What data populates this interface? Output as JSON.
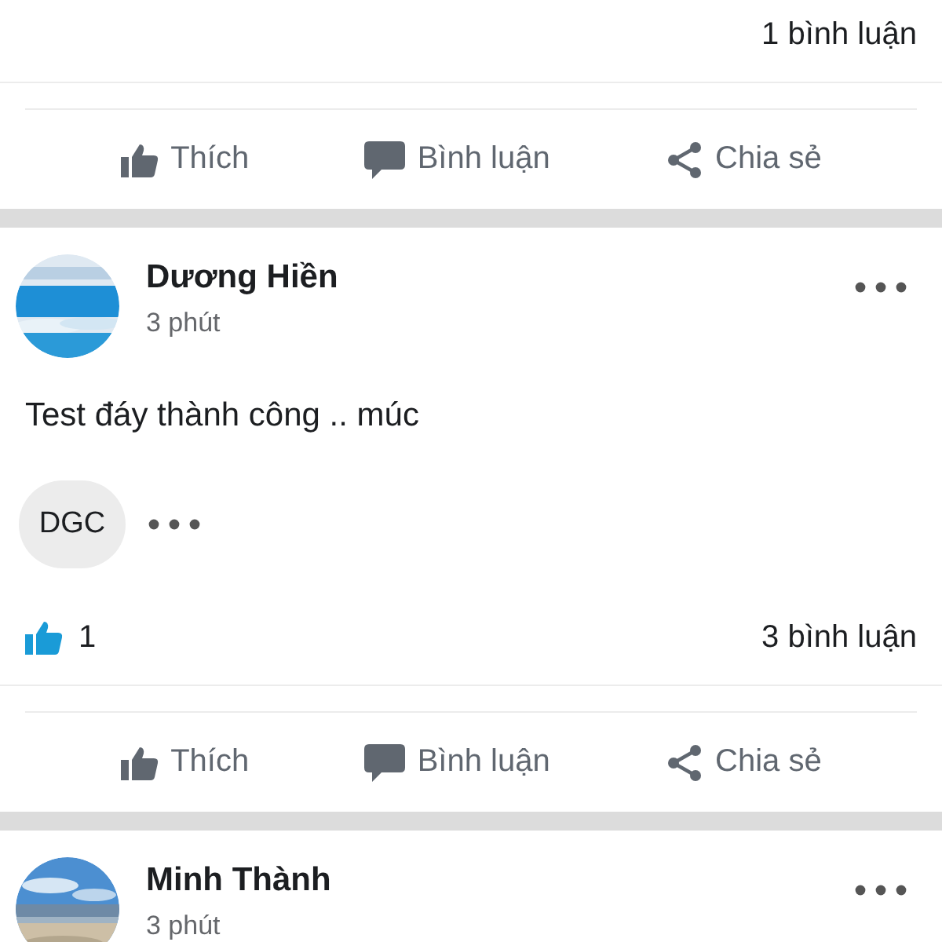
{
  "previous_post": {
    "comment_count": "1 bình luận",
    "actions": [
      {
        "kind": "like",
        "label": "Thích"
      },
      {
        "kind": "comment",
        "label": "Bình luận"
      },
      {
        "kind": "share",
        "label": "Chia sẻ"
      }
    ]
  },
  "posts": [
    {
      "author": "Dương Hiền",
      "time": "3 phút",
      "text": "Test đáy thành công .. múc",
      "reaction_chip": "DGC",
      "like_count": "1",
      "comment_count": "3 bình luận",
      "actions": [
        {
          "kind": "like",
          "label": "Thích"
        },
        {
          "kind": "comment",
          "label": "Bình luận"
        },
        {
          "kind": "share",
          "label": "Chia sẻ"
        }
      ]
    },
    {
      "author": "Minh Thành",
      "time": "3 phút"
    }
  ]
}
